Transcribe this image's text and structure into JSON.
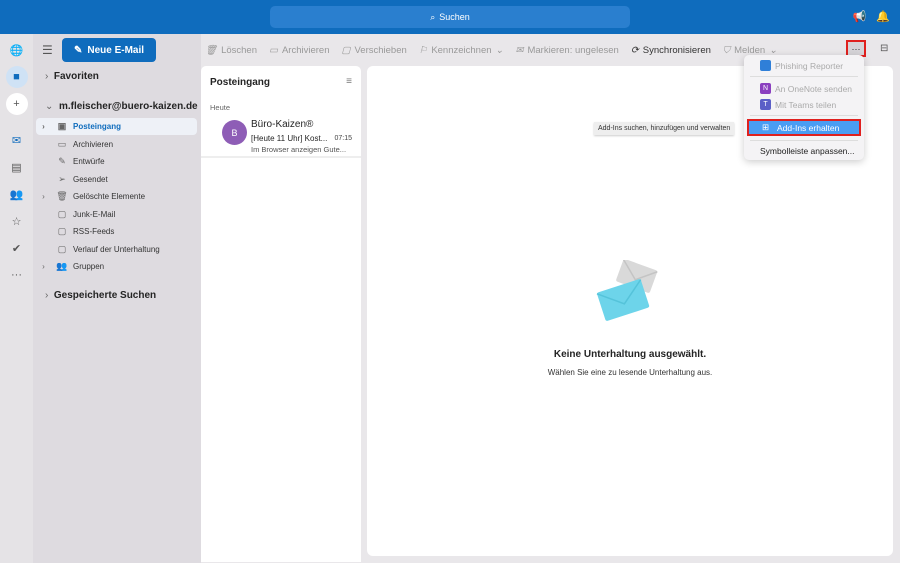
{
  "search": {
    "placeholder": "Suchen"
  },
  "toolbar": {
    "new_mail": "Neue E-Mail",
    "delete": "Löschen",
    "archive": "Archivieren",
    "move": "Verschieben",
    "flag": "Kennzeichnen",
    "mark_unread": "Markieren: ungelesen",
    "sync": "Synchronisieren",
    "report": "Melden",
    "more": "···"
  },
  "nav": {
    "favorites": "Favoriten",
    "account": "m.fleischer@buero-kaizen.de",
    "saved_searches": "Gespeicherte Suchen",
    "folders": [
      {
        "label": "Posteingang",
        "icon": "inbox-icon"
      },
      {
        "label": "Archivieren",
        "icon": "archive-icon"
      },
      {
        "label": "Entwürfe",
        "icon": "drafts-icon"
      },
      {
        "label": "Gesendet",
        "icon": "sent-icon"
      },
      {
        "label": "Gelöschte Elemente",
        "icon": "trash-icon"
      },
      {
        "label": "Junk-E-Mail",
        "icon": "junk-icon"
      },
      {
        "label": "RSS-Feeds",
        "icon": "folder-icon"
      },
      {
        "label": "Verlauf der Unterhaltung",
        "icon": "folder-icon"
      },
      {
        "label": "Gruppen",
        "icon": "groups-icon"
      }
    ]
  },
  "list": {
    "title": "Posteingang",
    "group": "Heute",
    "messages": [
      {
        "avatar": "B",
        "sender": "Büro-Kaizen®",
        "subject": "[Heute 11 Uhr] Kost...",
        "time": "07:15",
        "preview": "Im Browser anzeigen Gute..."
      }
    ]
  },
  "reading": {
    "title": "Keine Unterhaltung ausgewählt.",
    "subtitle": "Wählen Sie eine zu lesende Unterhaltung aus."
  },
  "tooltip": "Add-Ins suchen, hinzufügen und verwalten",
  "menu": {
    "items": [
      "Phishing Reporter",
      "An OneNote senden",
      "Mit Teams teilen",
      "Add-Ins erhalten",
      "Symbolleiste anpassen..."
    ]
  },
  "colors": {
    "accent": "#0f6cbd",
    "highlight": "#4a9df3",
    "marker": "#e0201e"
  }
}
